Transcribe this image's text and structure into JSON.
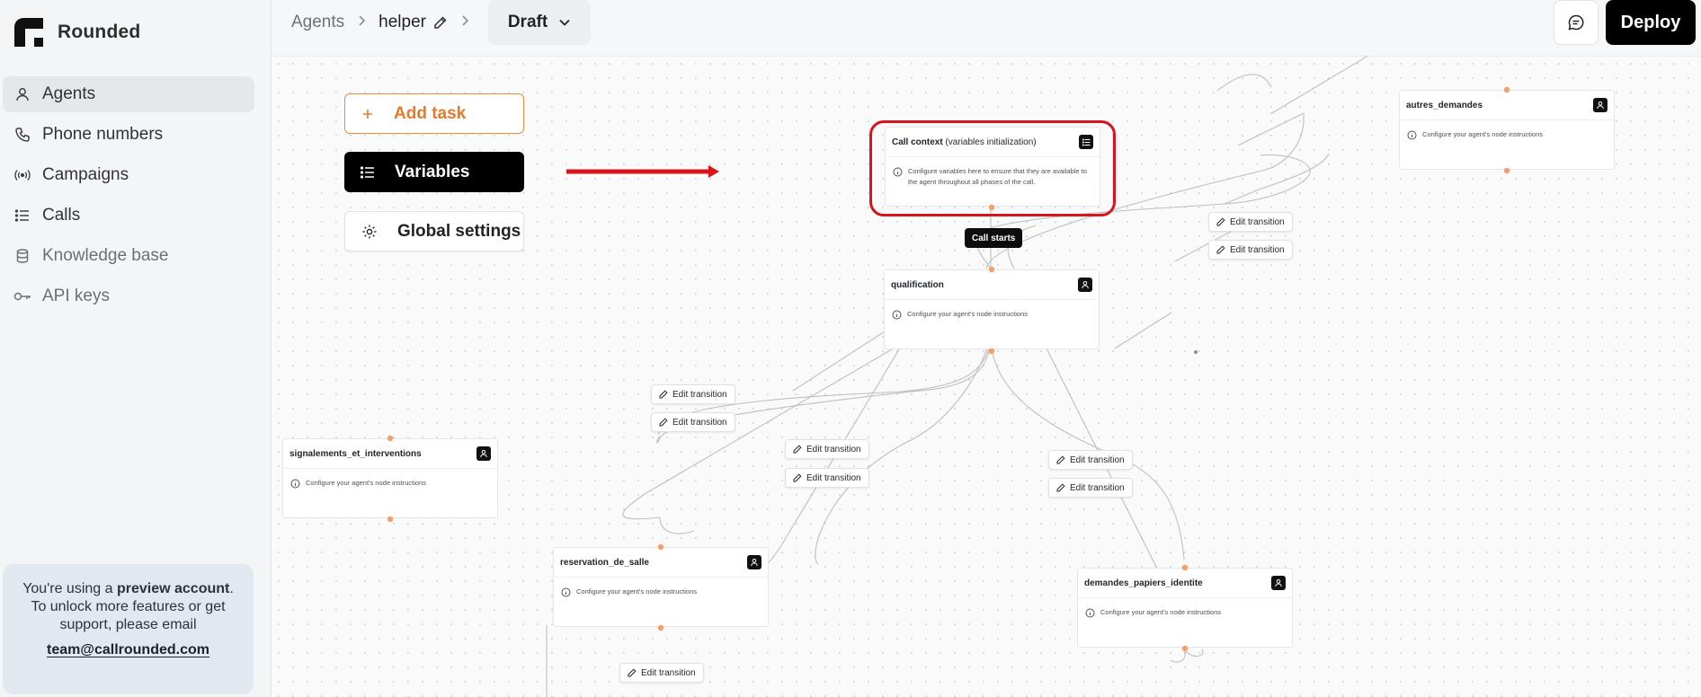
{
  "app": {
    "brand": "Rounded"
  },
  "sidebar": {
    "items": [
      {
        "label": "Agents",
        "icon": "user-icon",
        "active": true
      },
      {
        "label": "Phone numbers",
        "icon": "phone-icon",
        "active": false
      },
      {
        "label": "Campaigns",
        "icon": "broadcast-icon",
        "active": false
      },
      {
        "label": "Calls",
        "icon": "list-icon",
        "active": false
      },
      {
        "label": "Knowledge base",
        "icon": "database-icon",
        "active": false
      },
      {
        "label": "API keys",
        "icon": "key-icon",
        "active": false
      }
    ],
    "preview": {
      "line_prefix": "You're using a ",
      "bold": "preview account",
      "line_suffix": ". To unlock more features or get support, please email",
      "email": "team@callrounded.com"
    }
  },
  "header": {
    "breadcrumb": [
      "Agents",
      "helper"
    ],
    "version": "Draft",
    "deploy_label": "Deploy"
  },
  "toolbar": {
    "add_task": "Add task",
    "variables": "Variables",
    "global_settings": "Global settings"
  },
  "nodes": {
    "call_context": {
      "title": "Call context",
      "subtitle": "(variables initialization)",
      "description": "Configure variables here to ensure that they are available to the agent throughout all phases of the call."
    },
    "qualification": {
      "title": "qualification",
      "description": "Configure your agent's node instructions"
    },
    "autres_demandes": {
      "title": "autres_demandes",
      "description": "Configure your agent's node instructions"
    },
    "signalements": {
      "title": "signalements_et_interventions",
      "description": "Configure your agent's node instructions"
    },
    "reservation": {
      "title": "reservation_de_salle",
      "description": "Configure your agent's node instructions"
    },
    "demandes": {
      "title": "demandes_papiers_identite",
      "description": "Configure your agent's node instructions"
    }
  },
  "edges": {
    "call_starts": "Call starts",
    "edit_transition": "Edit transition"
  },
  "colors": {
    "accent": "#e8782a",
    "handle": "#f4a06a",
    "highlight": "#d8141c",
    "edge": "#bdbfc3"
  }
}
